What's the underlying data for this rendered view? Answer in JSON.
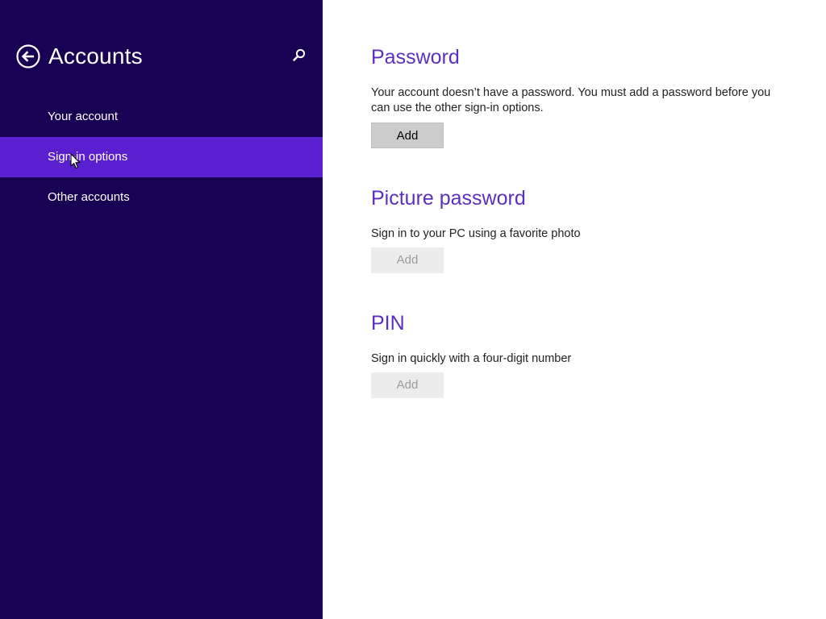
{
  "nav": {
    "title": "Accounts",
    "back_icon": "back-arrow-icon",
    "search_icon": "search-icon",
    "background": "#180052",
    "selected_color": "#5a1fcf",
    "items": [
      {
        "label": "Your account",
        "selected": false
      },
      {
        "label": "Sign-in options",
        "selected": true
      },
      {
        "label": "Other accounts",
        "selected": false
      }
    ]
  },
  "content": {
    "accent": "#5b2fbf",
    "password": {
      "title": "Password",
      "description": "Your account doesn’t have a password. You must add a password before you can use the other sign-in options.",
      "button_label": "Add",
      "button_enabled": true
    },
    "picture_password": {
      "title": "Picture password",
      "description": "Sign in to your PC using a favorite photo",
      "button_label": "Add",
      "button_enabled": false
    },
    "pin": {
      "title": "PIN",
      "description": "Sign in quickly with a four-digit number",
      "button_label": "Add",
      "button_enabled": false
    }
  }
}
